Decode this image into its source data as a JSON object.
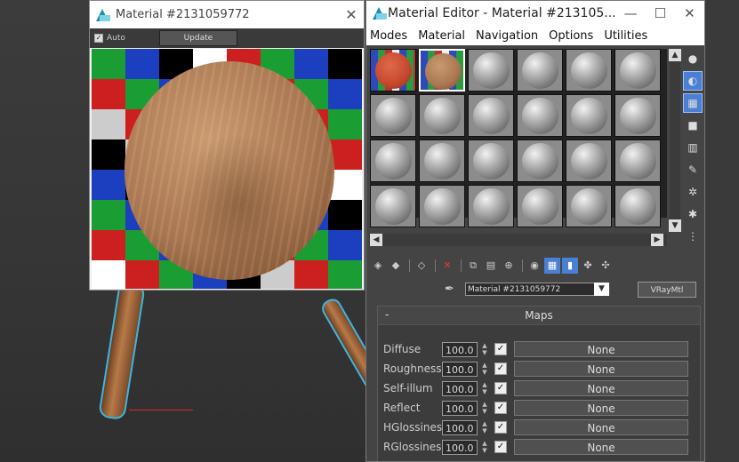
{
  "preview": {
    "title": "Material #2131059772",
    "auto_label": "Auto",
    "auto_checked": true,
    "update_label": "Update",
    "checker_colors": [
      "#1a9e34",
      "#1c3fc0",
      "#000000",
      "#ffffff",
      "#cc2020",
      "#1a9e34",
      "#1c3fc0",
      "#000000",
      "#cc2020",
      "#1a9e34",
      "#1c3fc0",
      "#000000",
      "#ffffff",
      "#cc2020",
      "#1a9e34",
      "#1c3fc0",
      "#cccccc",
      "#cc2020",
      "#1a9e34",
      "#1c3fc0",
      "#000000",
      "#ffffff",
      "#cc2020",
      "#1a9e34",
      "#000000",
      "#cccccc",
      "#cc2020",
      "#1a9e34",
      "#1c3fc0",
      "#000000",
      "#ffffff",
      "#cc2020",
      "#1c3fc0",
      "#000000",
      "#cccccc",
      "#cc2020",
      "#1a9e34",
      "#1c3fc0",
      "#000000",
      "#ffffff",
      "#1a9e34",
      "#1c3fc0",
      "#000000",
      "#cccccc",
      "#cc2020",
      "#1a9e34",
      "#1c3fc0",
      "#000000",
      "#cc2020",
      "#1a9e34",
      "#1c3fc0",
      "#000000",
      "#cccccc",
      "#cc2020",
      "#1a9e34",
      "#1c3fc0",
      "#ffffff",
      "#cc2020",
      "#1a9e34",
      "#1c3fc0",
      "#000000",
      "#cccccc",
      "#cc2020",
      "#1a9e34"
    ]
  },
  "editor": {
    "title": "Material Editor - Material #213105...",
    "menu": [
      "Modes",
      "Material",
      "Navigation",
      "Options",
      "Utilities"
    ],
    "slot_count": 24,
    "active_slot": 1,
    "material_name": "Material #2131059772",
    "material_type": "VRayMtl",
    "maps_title": "Maps",
    "maps_collapse": "-",
    "maps": [
      {
        "label": "Diffuse",
        "value": "100.0",
        "checked": true,
        "map": "None"
      },
      {
        "label": "Roughness",
        "value": "100.0",
        "checked": true,
        "map": "None"
      },
      {
        "label": "Self-illum",
        "value": "100.0",
        "checked": true,
        "map": "None"
      },
      {
        "label": "Reflect",
        "value": "100.0",
        "checked": true,
        "map": "None"
      },
      {
        "label": "HGlossiness",
        "value": "100.0",
        "checked": true,
        "map": "None"
      },
      {
        "label": "RGlossiness",
        "value": "100.0",
        "checked": true,
        "map": "None"
      }
    ]
  },
  "colors": {
    "accent": "#4a7fd4",
    "selection_outline": "#3fb6e0"
  }
}
